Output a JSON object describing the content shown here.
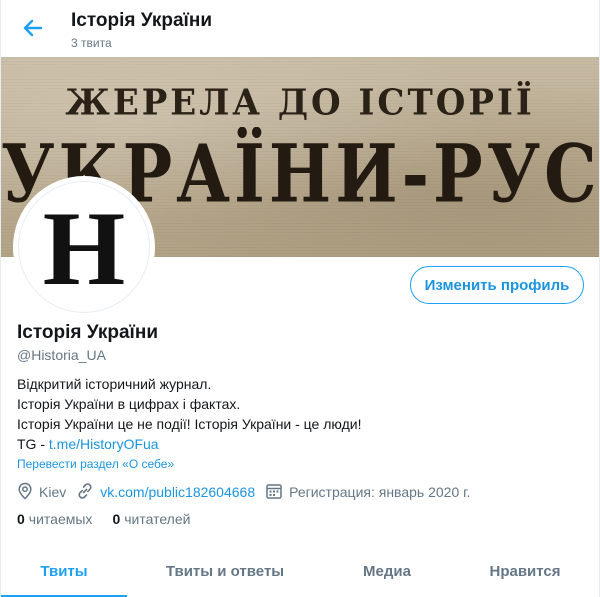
{
  "header": {
    "title": "Історія України",
    "subtitle": "3 твита",
    "back_icon": "arrow-left-icon"
  },
  "banner": {
    "line1": "ЖЕРЕЛА ДО ІСТОРІЇ",
    "line2": "УКРАЇНИ-РУСИ"
  },
  "avatar": {
    "mark": "H"
  },
  "edit_button": {
    "label": "Изменить профиль"
  },
  "profile": {
    "name": "Історія України",
    "handle": "@Historia_UA",
    "bio": {
      "line1": "Відкритий історичний журнал.",
      "line2": "Історія України в цифрах і фактах.",
      "line3": "Історія України це не події! Історія України - це люди!",
      "line4_prefix": "TG - ",
      "line4_link": "t.me/HistoryOFua"
    },
    "translate_label": "Перевести раздел «О себе»",
    "location": "Kiev",
    "website": "vk.com/public182604668",
    "joined": "Регистрация: январь 2020 г."
  },
  "stats": {
    "following_count": "0",
    "following_label": "читаемых",
    "followers_count": "0",
    "followers_label": "читателей"
  },
  "tabs": [
    {
      "label": "Твиты",
      "active": true
    },
    {
      "label": "Твиты и ответы",
      "active": false
    },
    {
      "label": "Медиа",
      "active": false
    },
    {
      "label": "Нравится",
      "active": false
    }
  ],
  "colors": {
    "accent": "#1da1f2",
    "link": "#1b95e0",
    "muted": "#657786",
    "text": "#14171a"
  }
}
